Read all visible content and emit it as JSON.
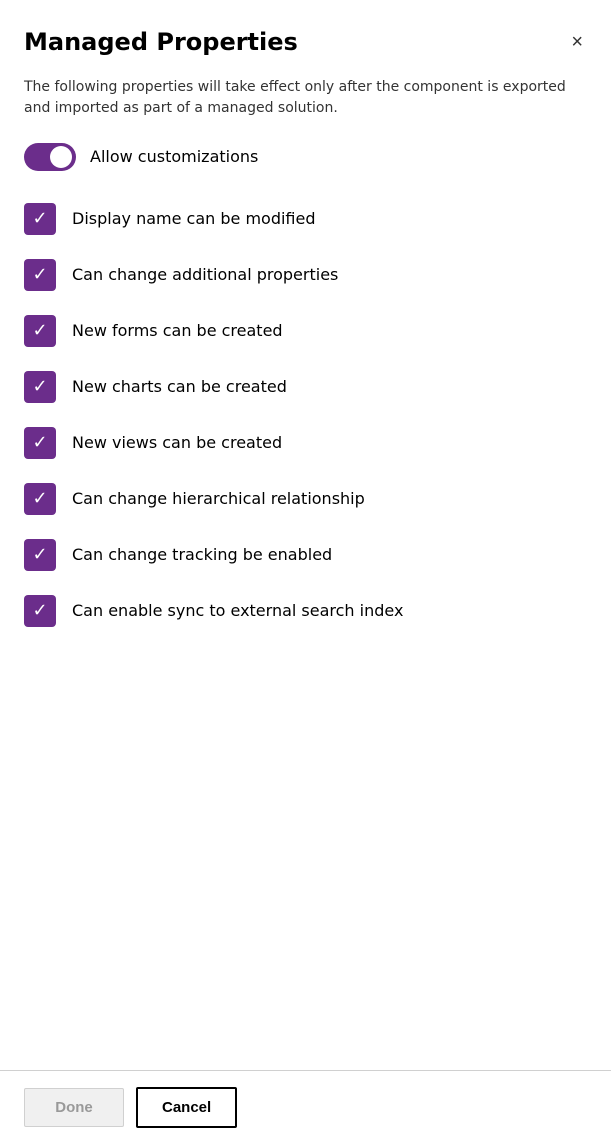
{
  "dialog": {
    "title": "Managed Properties",
    "description": "The following properties will take effect only after the component is exported and imported as part of a managed solution.",
    "close_label": "×"
  },
  "toggle": {
    "label": "Allow customizations",
    "checked": true
  },
  "checkboxes": [
    {
      "id": "display-name",
      "label": "Display name can be modified",
      "checked": true
    },
    {
      "id": "additional-props",
      "label": "Can change additional properties",
      "checked": true
    },
    {
      "id": "new-forms",
      "label": "New forms can be created",
      "checked": true
    },
    {
      "id": "new-charts",
      "label": "New charts can be created",
      "checked": true
    },
    {
      "id": "new-views",
      "label": "New views can be created",
      "checked": true
    },
    {
      "id": "hierarchical",
      "label": "Can change hierarchical relationship",
      "checked": true
    },
    {
      "id": "tracking",
      "label": "Can change tracking be enabled",
      "checked": true
    },
    {
      "id": "external-search",
      "label": "Can enable sync to external search index",
      "checked": true
    }
  ],
  "footer": {
    "done_label": "Done",
    "cancel_label": "Cancel"
  },
  "colors": {
    "purple": "#6B2D8B",
    "white": "#ffffff"
  }
}
